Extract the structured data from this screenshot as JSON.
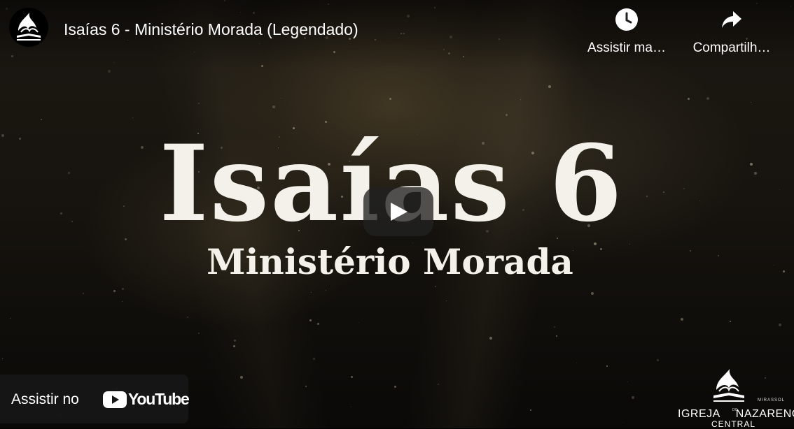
{
  "player": {
    "title": "Isaías 6 - Ministério Morada (Legendado)",
    "channel_logo_icon": "nazarene-flame-logo-icon",
    "actions": [
      {
        "label": "Assistir ma…",
        "icon": "clock-icon"
      },
      {
        "label": "Compartilh…",
        "icon": "share-arrow-icon"
      }
    ],
    "play_icon": "play-icon",
    "watch_on": {
      "label": "Assistir no",
      "brand": "YouTube",
      "icon": "youtube-logo-icon"
    }
  },
  "thumbnail": {
    "title_line1": "Isaías 6",
    "title_line2": "Ministério Morada"
  },
  "watermark": {
    "city": "MIRASSOL",
    "name_left": "IGREJA",
    "name_mid": "DO",
    "name_right": "NAZARENO",
    "sub": "CENTRAL"
  },
  "colors": {
    "background": "#17140f",
    "text": "#ffffff",
    "title_text": "#f4f1ea",
    "control_bg": "#212121"
  }
}
